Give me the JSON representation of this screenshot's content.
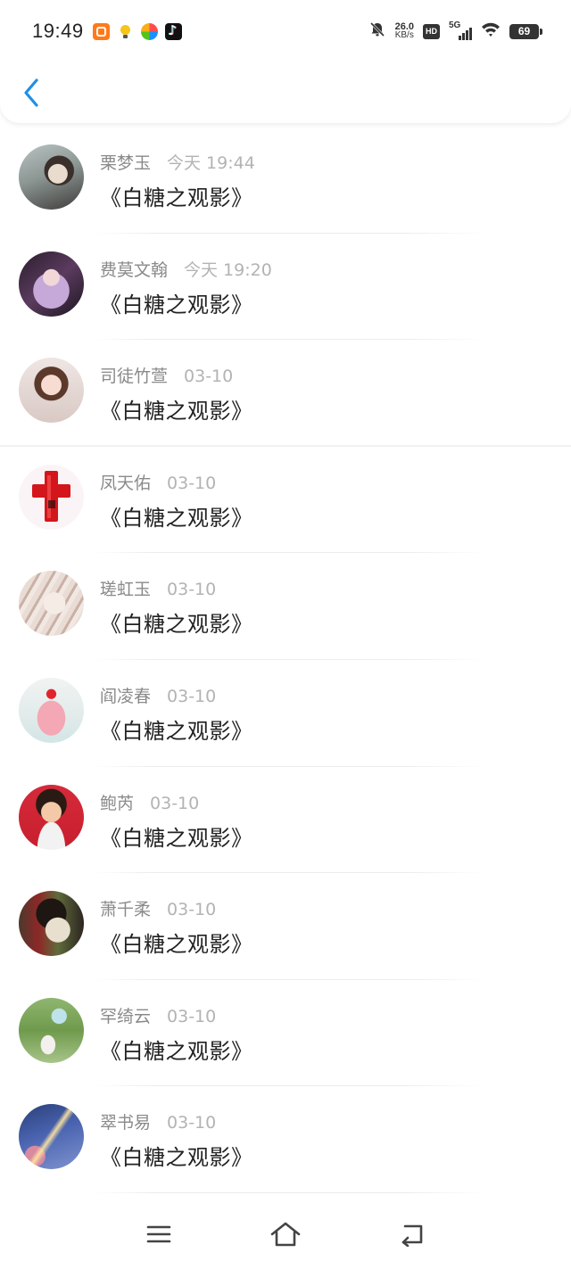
{
  "status_bar": {
    "time": "19:49",
    "net_speed_value": "26.0",
    "net_speed_unit": "KB/s",
    "hd_label": "HD",
    "network_label": "5G",
    "battery_level": "69",
    "app_icons": [
      "orange-app-icon",
      "bulb-app-icon",
      "pinwheel-app-icon",
      "tiktok-app-icon"
    ],
    "icons": [
      "mute-bell-icon",
      "wifi-icon",
      "signal-icon",
      "battery-icon"
    ]
  },
  "header": {
    "back_icon": "chevron-left-icon",
    "accent_color": "#1e90e6"
  },
  "messages": [
    {
      "name": "栗梦玉",
      "time": "今天 19:44",
      "title": "《白糖之观影》"
    },
    {
      "name": "费莫文翰",
      "time": "今天 19:20",
      "title": "《白糖之观影》"
    },
    {
      "name": "司徒竹萱",
      "time": "03-10",
      "title": "《白糖之观影》"
    },
    {
      "name": "凤天佑",
      "time": "03-10",
      "title": "《白糖之观影》"
    },
    {
      "name": "瑳虹玉",
      "time": "03-10",
      "title": "《白糖之观影》"
    },
    {
      "name": "阎凌春",
      "time": "03-10",
      "title": "《白糖之观影》"
    },
    {
      "name": "鲍芮",
      "time": "03-10",
      "title": "《白糖之观影》"
    },
    {
      "name": "萧千柔",
      "time": "03-10",
      "title": "《白糖之观影》"
    },
    {
      "name": "罕绮云",
      "time": "03-10",
      "title": "《白糖之观影》"
    },
    {
      "name": "翠书易",
      "time": "03-10",
      "title": "《白糖之观影》"
    }
  ],
  "nav_bar": {
    "icons": [
      "menu-icon",
      "home-icon",
      "back-icon"
    ]
  }
}
